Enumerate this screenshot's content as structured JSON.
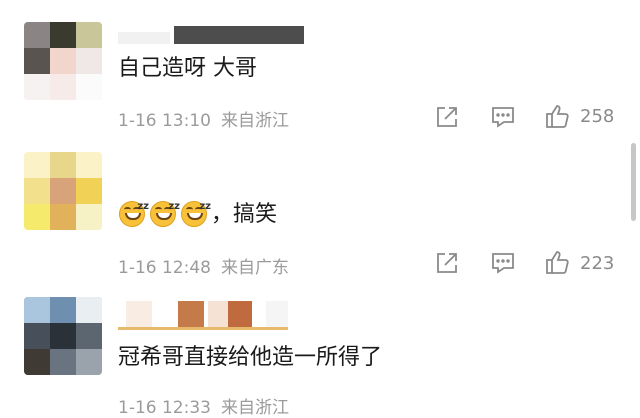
{
  "comments": [
    {
      "text": "自己造呀 大哥",
      "time": "1-16 13:10",
      "location": "来自浙江",
      "likes": "258"
    },
    {
      "emoji_count": 3,
      "emoji_name": "sleepy-smile-emoji",
      "text_suffix": "，搞笑",
      "time": "1-16 12:48",
      "location": "来自广东",
      "likes": "223"
    },
    {
      "text": "冠希哥直接给他造一所得了",
      "time": "1-16 12:33",
      "location": "来自浙江"
    }
  ],
  "actions": {
    "share_icon": "share-icon",
    "reply_icon": "comment-icon",
    "like_icon": "thumbs-up-icon"
  },
  "colors": {
    "meta_text": "#9b9b9b",
    "icon": "#8a8a8a",
    "body_text": "#1a1a1a"
  }
}
